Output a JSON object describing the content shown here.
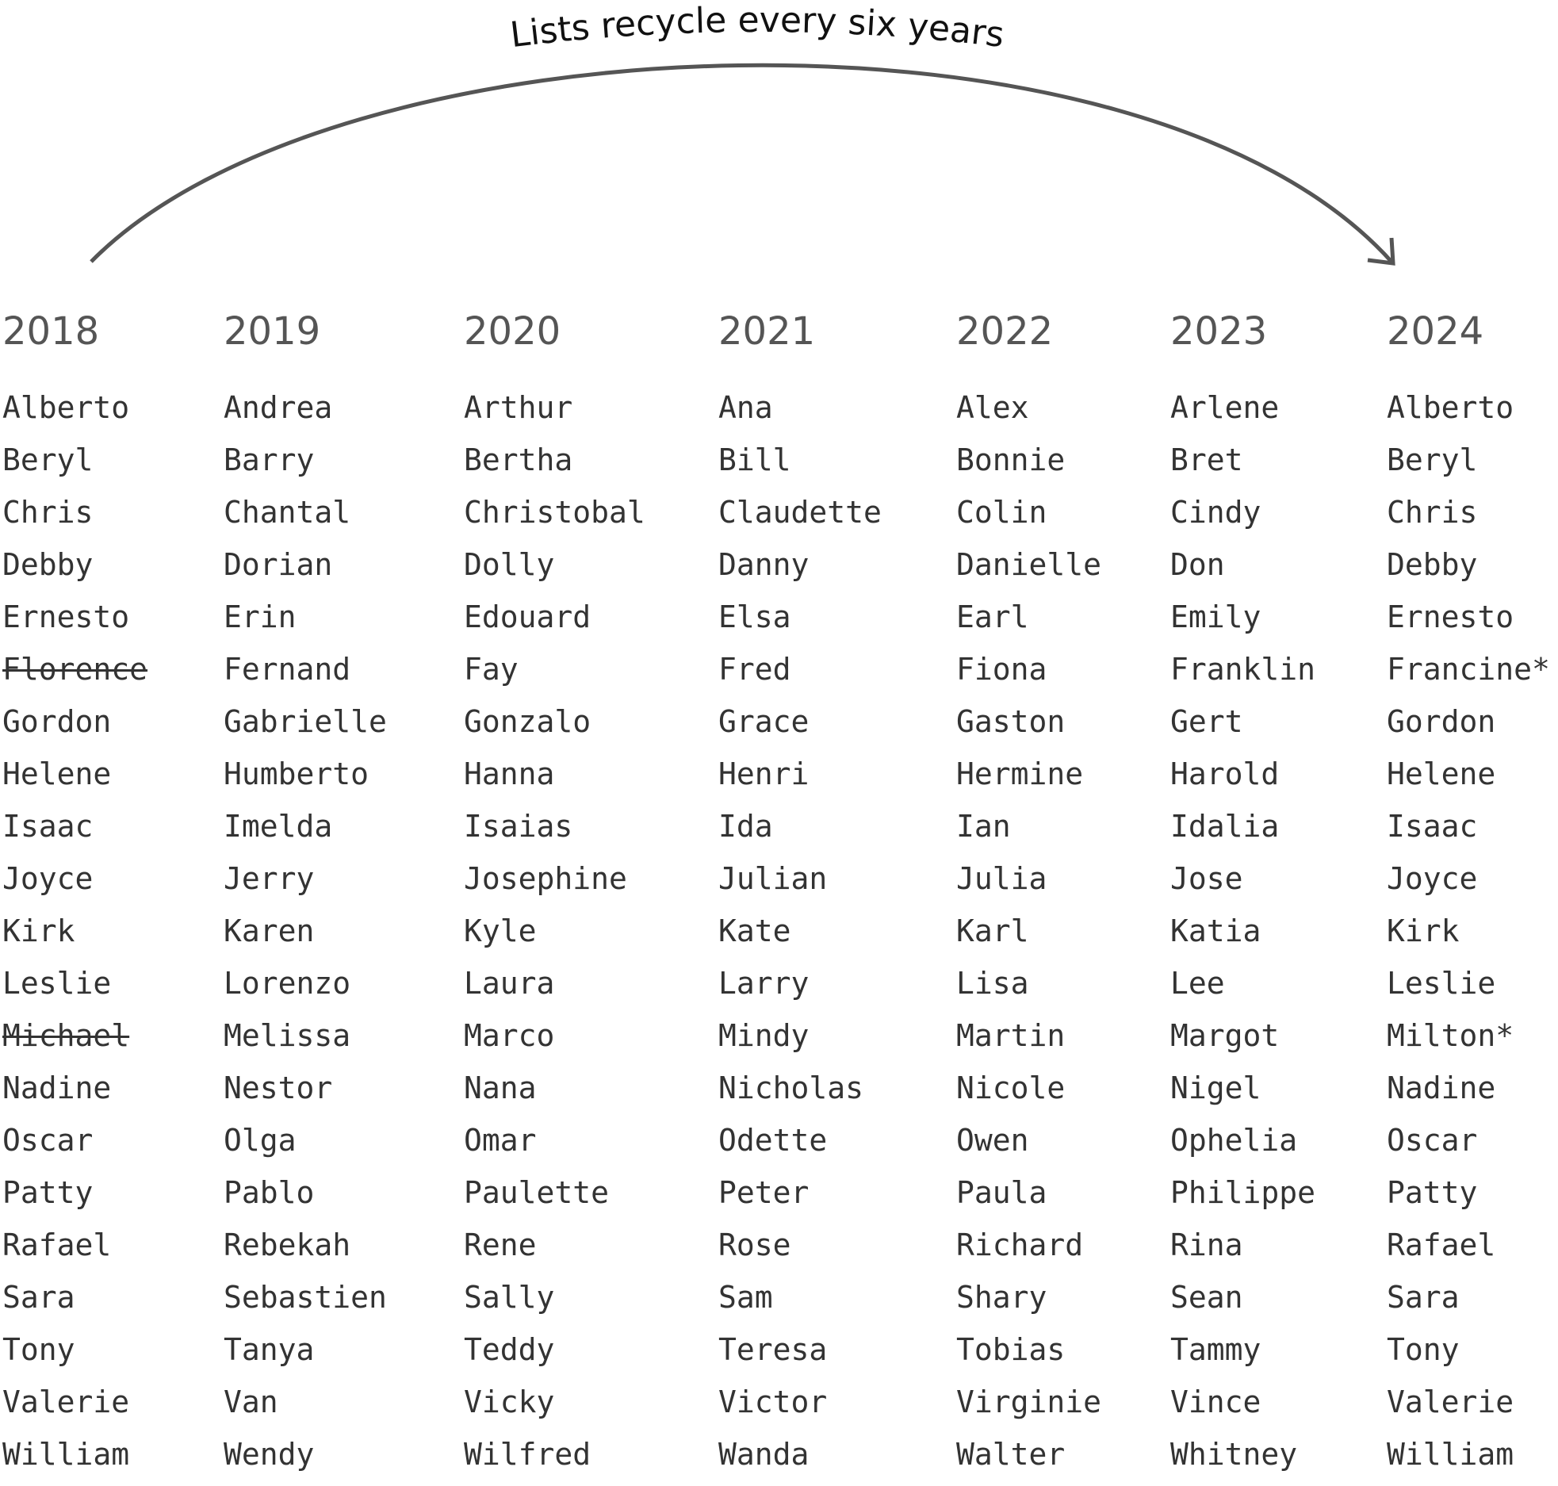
{
  "recycle_label": "Lists recycle every six years",
  "columns": [
    {
      "year": "2018",
      "names": [
        "Alberto",
        "Beryl",
        "Chris",
        "Debby",
        "Ernesto",
        "Florence",
        "Gordon",
        "Helene",
        "Isaac",
        "Joyce",
        "Kirk",
        "Leslie",
        "Michael",
        "Nadine",
        "Oscar",
        "Patty",
        "Rafael",
        "Sara",
        "Tony",
        "Valerie",
        "William"
      ],
      "retired": [
        "Florence",
        "Michael"
      ]
    },
    {
      "year": "2019",
      "names": [
        "Andrea",
        "Barry",
        "Chantal",
        "Dorian",
        "Erin",
        "Fernand",
        "Gabrielle",
        "Humberto",
        "Imelda",
        "Jerry",
        "Karen",
        "Lorenzo",
        "Melissa",
        "Nestor",
        "Olga",
        "Pablo",
        "Rebekah",
        "Sebastien",
        "Tanya",
        "Van",
        "Wendy"
      ],
      "retired": []
    },
    {
      "year": "2020",
      "names": [
        "Arthur",
        "Bertha",
        "Christobal",
        "Dolly",
        "Edouard",
        "Fay",
        "Gonzalo",
        "Hanna",
        "Isaias",
        "Josephine",
        "Kyle",
        "Laura",
        "Marco",
        "Nana",
        "Omar",
        "Paulette",
        "Rene",
        "Sally",
        "Teddy",
        "Vicky",
        "Wilfred"
      ],
      "retired": []
    },
    {
      "year": "2021",
      "names": [
        "Ana",
        "Bill",
        "Claudette",
        "Danny",
        "Elsa",
        "Fred",
        "Grace",
        "Henri",
        "Ida",
        "Julian",
        "Kate",
        "Larry",
        "Mindy",
        "Nicholas",
        "Odette",
        "Peter",
        "Rose",
        "Sam",
        "Teresa",
        "Victor",
        "Wanda"
      ],
      "retired": []
    },
    {
      "year": "2022",
      "names": [
        "Alex",
        "Bonnie",
        "Colin",
        "Danielle",
        "Earl",
        "Fiona",
        "Gaston",
        "Hermine",
        "Ian",
        "Julia",
        "Karl",
        "Lisa",
        "Martin",
        "Nicole",
        "Owen",
        "Paula",
        "Richard",
        "Shary",
        "Tobias",
        "Virginie",
        "Walter"
      ],
      "retired": []
    },
    {
      "year": "2023",
      "names": [
        "Arlene",
        "Bret",
        "Cindy",
        "Don",
        "Emily",
        "Franklin",
        "Gert",
        "Harold",
        "Idalia",
        "Jose",
        "Katia",
        "Lee",
        "Margot",
        "Nigel",
        "Ophelia",
        "Philippe",
        "Rina",
        "Sean",
        "Tammy",
        "Vince",
        "Whitney"
      ],
      "retired": []
    },
    {
      "year": "2024",
      "names": [
        "Alberto",
        "Beryl",
        "Chris",
        "Debby",
        "Ernesto",
        "Francine*",
        "Gordon",
        "Helene",
        "Isaac",
        "Joyce",
        "Kirk",
        "Leslie",
        "Milton*",
        "Nadine",
        "Oscar",
        "Patty",
        "Rafael",
        "Sara",
        "Tony",
        "Valerie",
        "William"
      ],
      "retired": []
    }
  ]
}
